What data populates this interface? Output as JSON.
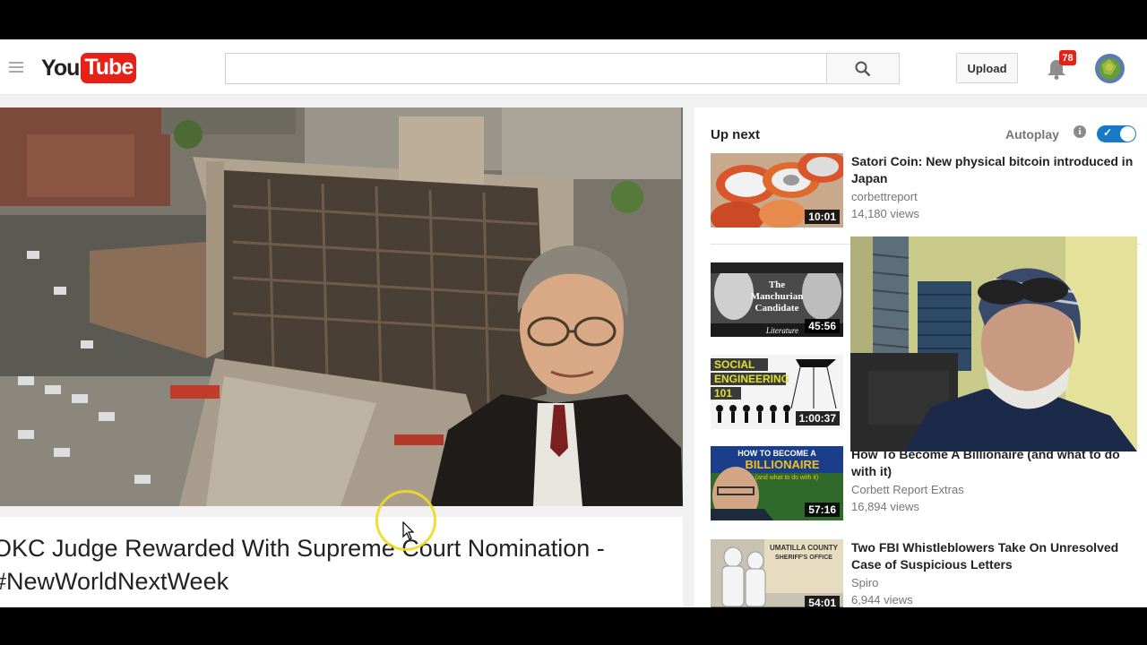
{
  "brand": {
    "you": "You",
    "tube": "Tube"
  },
  "header": {
    "search_placeholder": "",
    "upload_label": "Upload",
    "notification_count": "78"
  },
  "video": {
    "title": "OKC Judge Rewarded With Supreme Court Nomination - #NewWorldNextWeek"
  },
  "sidebar": {
    "up_next_label": "Up next",
    "autoplay_label": "Autoplay",
    "autoplay_on": true,
    "items": [
      {
        "title": "Satori Coin: New physical bitcoin introduced in Japan",
        "channel": "corbettreport",
        "views": "14,180 views",
        "duration": "10:01",
        "thumb_icon": "poker-chips-thumbnail"
      },
      {
        "title": "",
        "channel": "",
        "views": "",
        "duration": "45:56",
        "thumb_icon": "manchurian-candidate-thumbnail",
        "thumb_text": [
          "The",
          "Manchurian",
          "Candidate"
        ],
        "thumb_caption": "Literature"
      },
      {
        "title": "",
        "channel": "",
        "views": "",
        "duration": "1:00:37",
        "thumb_icon": "social-engineering-thumbnail",
        "thumb_text": [
          "SOCIAL",
          "ENGINEERING",
          "101"
        ]
      },
      {
        "title": "How To Become A Billionaire (and what to do with it)",
        "channel": "Corbett Report Extras",
        "views": "16,894 views",
        "duration": "57:16",
        "thumb_icon": "billionaire-thumbnail",
        "thumb_text": [
          "HOW TO BECOME A",
          "BILLIONAIRE",
          "(and what to do with it)"
        ]
      },
      {
        "title": "Two FBI Whistleblowers Take On Unresolved Case of Suspicious Letters",
        "channel": "Spiro",
        "views": "6,944 views",
        "duration": "54:01",
        "thumb_icon": "fbi-letters-thumbnail",
        "thumb_text": [
          "UMATILLA COUNTY",
          "SHERIFF'S OFFICE"
        ]
      }
    ]
  },
  "colors": {
    "brand_red": "#e62117",
    "toggle_blue": "#167ac6",
    "cursor_ring": "#f0dc1e"
  }
}
